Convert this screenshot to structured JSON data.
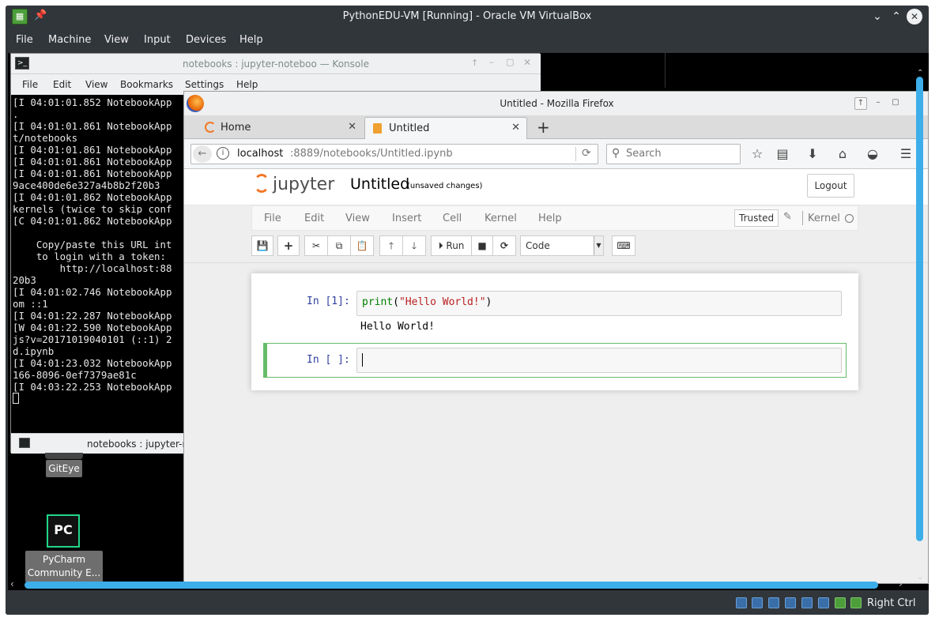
{
  "vbox": {
    "title": "PythonEDU-VM [Running] - Oracle VM VirtualBox",
    "menu": [
      "File",
      "Machine",
      "View",
      "Input",
      "Devices",
      "Help"
    ],
    "host_key": "Right Ctrl"
  },
  "konsole": {
    "title": "notebooks : jupyter-noteboo — Konsole",
    "menu": [
      "File",
      "Edit",
      "View",
      "Bookmarks",
      "Settings",
      "Help"
    ],
    "lines": [
      "[I 04:01:01.852 NotebookApp",
      ".",
      "[I 04:01:01.861 NotebookApp",
      "t/notebooks",
      "[I 04:01:01.861 NotebookApp",
      "[I 04:01:01.861 NotebookApp",
      "[I 04:01:01.861 NotebookApp",
      "9ace400de6e327a4b8b2f20b3",
      "[I 04:01:01.862 NotebookApp",
      "kernels (twice to skip conf",
      "[C 04:01:01.862 NotebookApp",
      "",
      "    Copy/paste this URL int",
      "    to login with a token:",
      "        http://localhost:88",
      "20b3",
      "[I 04:01:02.746 NotebookApp",
      "om ::1",
      "[I 04:01:22.287 NotebookApp",
      "[W 04:01:22.590 NotebookApp",
      "js?v=20171019040101 (::1) 2",
      "d.ipynb",
      "[I 04:01:23.032 NotebookApp",
      "166-8096-0ef7379ae81c",
      "[I 04:03:22.253 NotebookApp"
    ],
    "tab_label": "notebooks : jupyter-n"
  },
  "desktop": {
    "giteye_label": "GitEye",
    "pycharm_icon_text": "PC",
    "pycharm_label_1": "PyCharm",
    "pycharm_label_2": "Community E..."
  },
  "firefox": {
    "title": "Untitled - Mozilla Firefox",
    "tabs": [
      {
        "label": "Home"
      },
      {
        "label": "Untitled"
      }
    ],
    "url_host": "localhost",
    "url_rest": ":8889/notebooks/Untitled.ipynb",
    "search_placeholder": "Search"
  },
  "jupyter": {
    "logo_text": "jupyter",
    "notebook_name": "Untitled",
    "save_status": "(unsaved changes)",
    "logout_label": "Logout",
    "menu": [
      "File",
      "Edit",
      "View",
      "Insert",
      "Cell",
      "Kernel",
      "Help"
    ],
    "trusted_label": "Trusted",
    "kernel_name": "Kernel",
    "run_label": "Run",
    "cell_type": "Code",
    "cells": [
      {
        "prompt": "In [1]:",
        "code_func": "print",
        "code_open": "(",
        "code_string": "\"Hello World!\"",
        "code_close": ")",
        "output": "Hello World!"
      },
      {
        "prompt": "In [ ]:",
        "code": ""
      }
    ]
  },
  "colors": {
    "jupyter_orange": "#f37726",
    "prompt_blue": "#303f9f",
    "selected_cell_green": "#66bb6a",
    "scrollbar_blue": "#3daee9"
  }
}
